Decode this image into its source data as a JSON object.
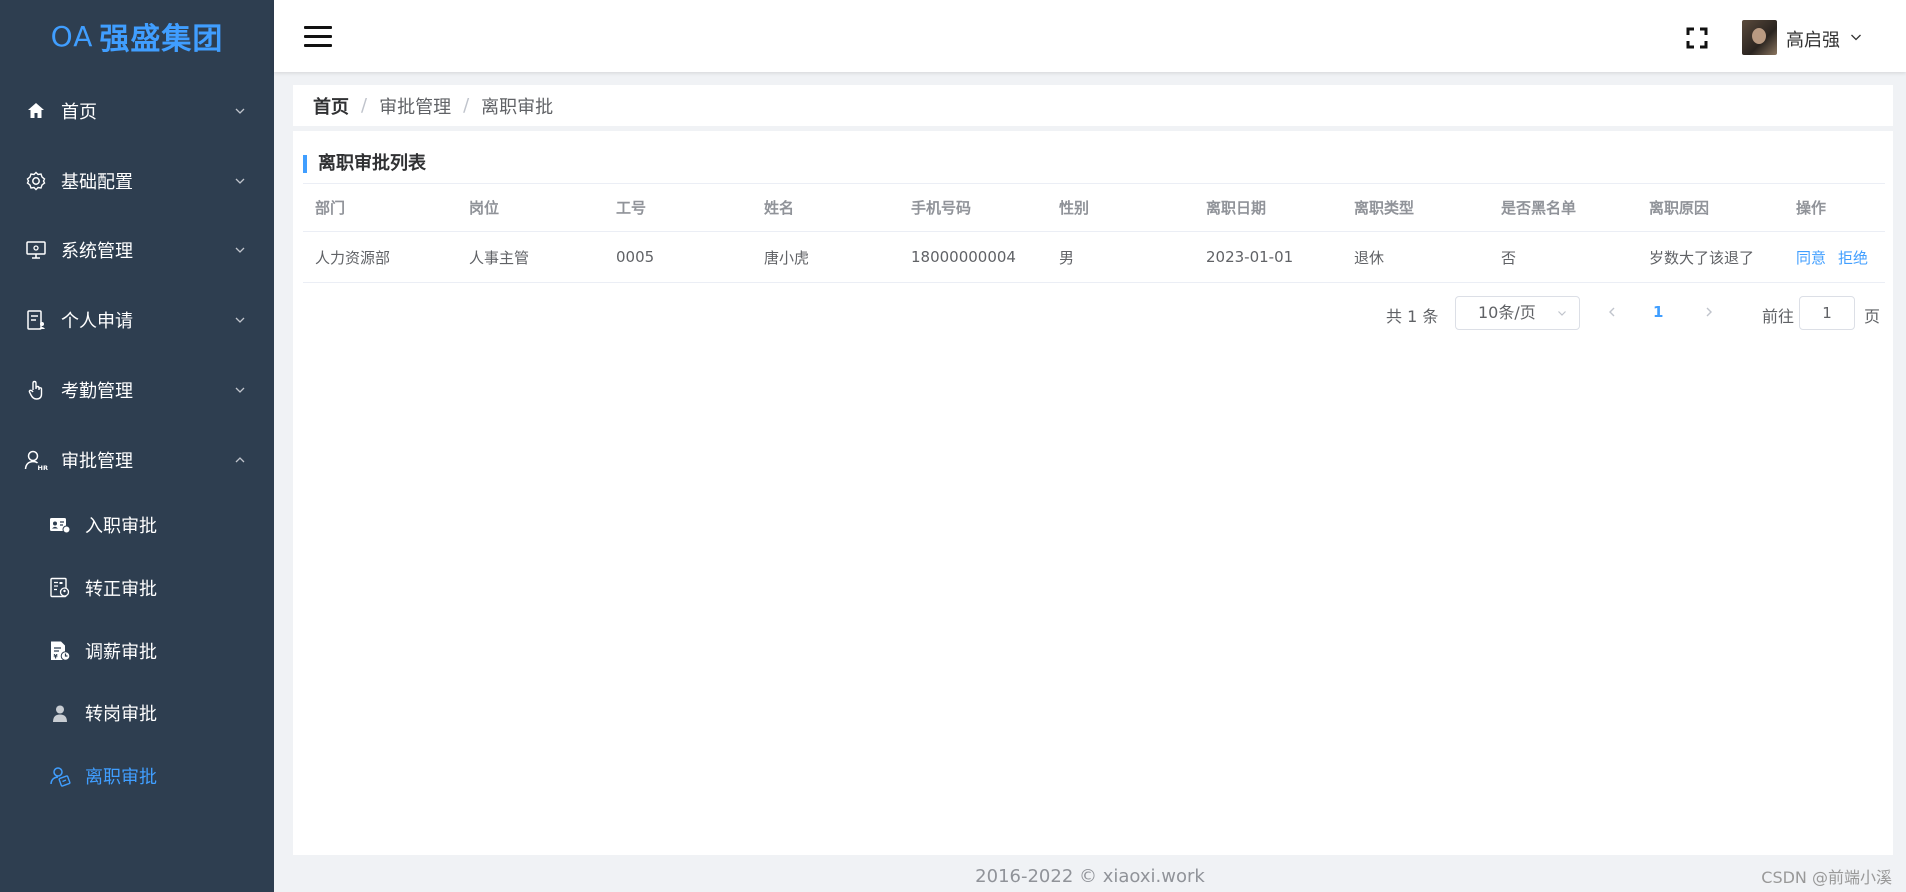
{
  "brand": {
    "logo_prefix": "OA",
    "logo_text": "强盛集团",
    "accent_color": "#409eff",
    "sidebar_bg": "#2e3e50"
  },
  "sidebar": {
    "items": [
      {
        "label": "首页",
        "icon": "home-icon",
        "expanded": false
      },
      {
        "label": "基础配置",
        "icon": "gear-icon",
        "expanded": false
      },
      {
        "label": "系统管理",
        "icon": "monitor-icon",
        "expanded": false
      },
      {
        "label": "个人申请",
        "icon": "document-user-icon",
        "expanded": false
      },
      {
        "label": "考勤管理",
        "icon": "hand-icon",
        "expanded": false
      },
      {
        "label": "审批管理",
        "icon": "hr-user-icon",
        "expanded": true
      }
    ],
    "sub_items": [
      {
        "label": "入职审批",
        "icon": "id-card-icon",
        "active": false
      },
      {
        "label": "转正审批",
        "icon": "form-user-icon",
        "active": false
      },
      {
        "label": "调薪审批",
        "icon": "salary-document-icon",
        "active": false
      },
      {
        "label": "转岗审批",
        "icon": "person-icon",
        "active": false
      },
      {
        "label": "离职审批",
        "icon": "leave-icon",
        "active": true
      }
    ]
  },
  "header": {
    "username": "高启强"
  },
  "breadcrumb": [
    "首页",
    "审批管理",
    "离职审批"
  ],
  "card": {
    "title": "离职审批列表"
  },
  "table": {
    "columns": [
      "部门",
      "岗位",
      "工号",
      "姓名",
      "手机号码",
      "性别",
      "离职日期",
      "离职类型",
      "是否黑名单",
      "离职原因",
      "操作"
    ],
    "rows": [
      [
        "人力资源部",
        "人事主管",
        "0005",
        "唐小虎",
        "18000000004",
        "男",
        "2023-01-01",
        "退休",
        "否",
        "岁数大了该退了"
      ]
    ],
    "actions": [
      "同意",
      "拒绝"
    ]
  },
  "pagination": {
    "total_text": "共 1 条",
    "page_size": "10条/页",
    "current_page": "1",
    "goto_label": "前往",
    "goto_value": "1",
    "page_suffix": "页"
  },
  "footer": {
    "copyright": "2016-2022 © xiaoxi.work",
    "watermark": "CSDN @前端小溪"
  }
}
